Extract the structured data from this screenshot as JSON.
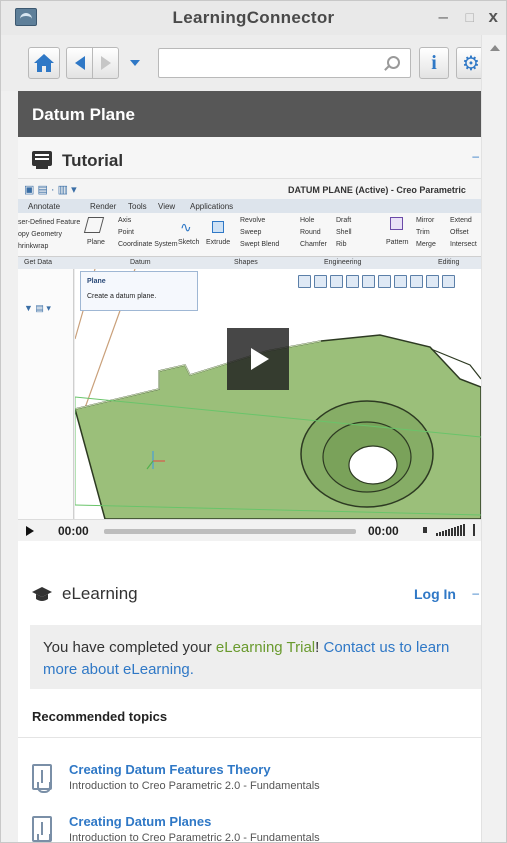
{
  "window": {
    "title": "LearningConnector",
    "minimize": "–",
    "maximize": "□",
    "close": "x"
  },
  "nav": {
    "search_placeholder": "",
    "info_label": "i",
    "gear_glyph": "⚙"
  },
  "section": {
    "title": "Datum Plane"
  },
  "tutorial": {
    "title": "Tutorial",
    "collapse": "–"
  },
  "video": {
    "screen": {
      "doc_title": "DATUM PLANE (Active) - Creo Parametric",
      "tabs": [
        "Annotate",
        "Render",
        "Tools",
        "View",
        "Applications"
      ],
      "ribbon_left": [
        "ser-Defined Feature",
        "opy Geometry",
        "hrinkwrap"
      ],
      "ribbon_plane": "Plane",
      "ribbon_datum": [
        "Axis",
        "Point",
        "Coordinate System"
      ],
      "ribbon_sketch": "Sketch",
      "ribbon_extrude": "Extrude",
      "ribbon_shapes": [
        "Revolve",
        "Sweep",
        "Swept Blend"
      ],
      "ribbon_engineering": [
        "Hole",
        "Draft",
        "Round",
        "Shell",
        "Chamfer",
        "Rib"
      ],
      "ribbon_pattern": "Pattern",
      "ribbon_editing": [
        "Mirror",
        "Extend",
        "Trim",
        "Offset",
        "Merge",
        "Intersect"
      ],
      "groups": [
        "Get Data",
        "Datum",
        "Shapes",
        "Engineering",
        "Editing"
      ],
      "tooltip_title": "Plane",
      "tooltip_desc": "Create a datum plane."
    },
    "time_current": "00:00",
    "time_total": "00:00",
    "progress": 0,
    "volume_level": 1.0
  },
  "elearning": {
    "title": "eLearning",
    "login": "Log In",
    "collapse": "–",
    "message_prefix": "You have completed your ",
    "message_highlight": "eLearning Trial",
    "message_mid": "! ",
    "message_link": "Contact us to learn more about eLearning."
  },
  "recommended": {
    "header": "Recommended topics",
    "items": [
      {
        "title": "Creating Datum Features Theory",
        "subtitle": "Introduction to Creo Parametric 2.0 - Fundamentals"
      },
      {
        "title": "Creating Datum Planes",
        "subtitle": "Introduction to Creo Parametric 2.0 - Fundamentals"
      }
    ]
  },
  "colors": {
    "accent": "#2f78c6",
    "header_bg": "#575757",
    "trial_green": "#6a9a2e",
    "model_green": "#9bbf7a"
  }
}
